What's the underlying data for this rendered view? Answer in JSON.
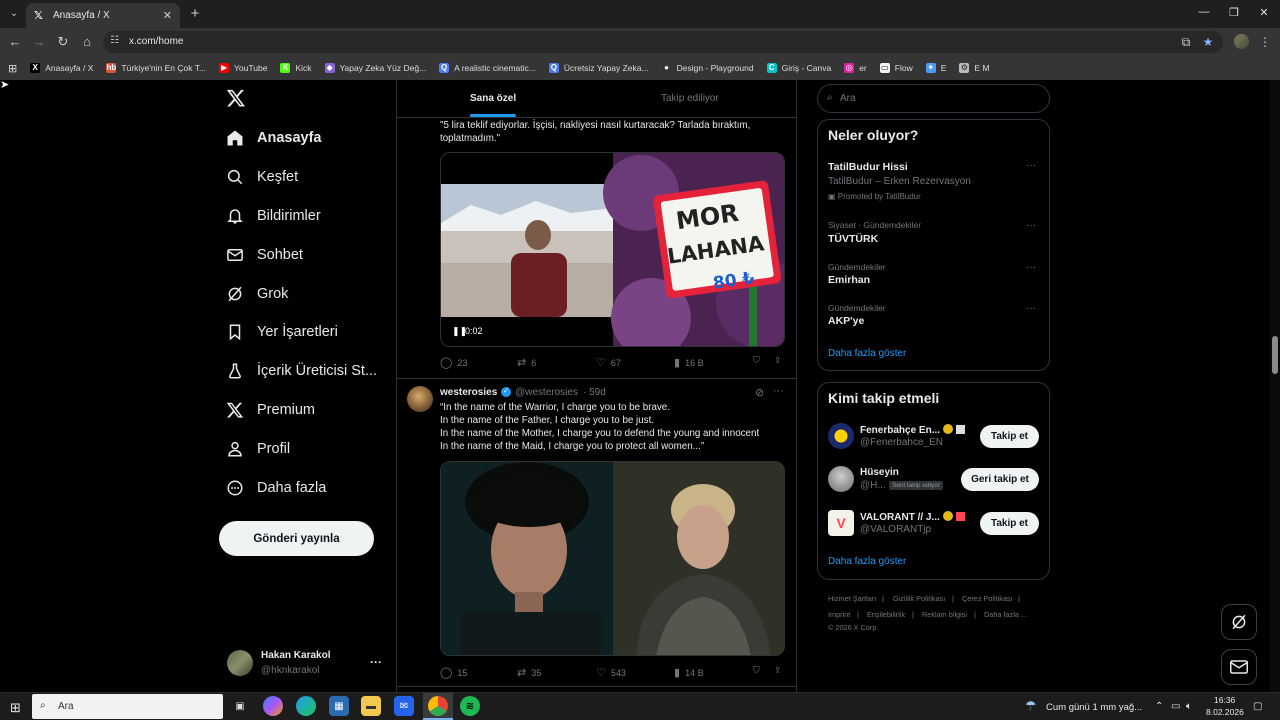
{
  "browser": {
    "tab_title": "Anasayfa / X",
    "url": "x.com/home",
    "bookmarks": [
      {
        "label": "Anasayfa / X",
        "color": "#000000",
        "glyph": "X"
      },
      {
        "label": "Türkiye'nin En Çok T...",
        "color": "#e0533a",
        "glyph": "hb"
      },
      {
        "label": "YouTube",
        "color": "#ff0000",
        "glyph": "▶"
      },
      {
        "label": "Kick",
        "color": "#53fc18",
        "glyph": "K"
      },
      {
        "label": "Yapay Zeka Yüz Değ...",
        "color": "#8a63d2",
        "glyph": "◆"
      },
      {
        "label": "A realistic cinematic...",
        "color": "#4b7bec",
        "glyph": "Q"
      },
      {
        "label": "Ücretsiz Yapay Zeka...",
        "color": "#4b7bec",
        "glyph": "Q"
      },
      {
        "label": "Design - Playground",
        "color": "#333333",
        "glyph": "●"
      },
      {
        "label": "Giriş - Canva",
        "color": "#00c4cc",
        "glyph": "C"
      },
      {
        "label": "er",
        "color": "#d6249f",
        "glyph": "◎"
      },
      {
        "label": "Flow",
        "color": "#f2f2f2",
        "glyph": "▭"
      },
      {
        "label": "E",
        "color": "#4b9cf5",
        "glyph": "✦"
      },
      {
        "label": "E M",
        "color": "#bbbbbb",
        "glyph": "⚙"
      }
    ]
  },
  "sidebar": {
    "items": [
      {
        "label": "Anasayfa",
        "icon": "home-icon"
      },
      {
        "label": "Keşfet",
        "icon": "search-icon"
      },
      {
        "label": "Bildirimler",
        "icon": "bell-icon"
      },
      {
        "label": "Sohbet",
        "icon": "mail-icon"
      },
      {
        "label": "Grok",
        "icon": "grok-icon"
      },
      {
        "label": "Yer İşaretleri",
        "icon": "bookmark-icon"
      },
      {
        "label": "İçerik Üreticisi St...",
        "icon": "flask-icon"
      },
      {
        "label": "Premium",
        "icon": "x-icon"
      },
      {
        "label": "Profil",
        "icon": "person-icon"
      },
      {
        "label": "Daha fazla",
        "icon": "more-circle-icon"
      }
    ],
    "post_button": "Gönderi yayınla",
    "profile": {
      "name": "Hakan Karakol",
      "handle": "@hknkarakol"
    }
  },
  "feed": {
    "tabs": [
      "Sana özel",
      "Takip ediliyor"
    ],
    "tweet1": {
      "text_lines": [
        "\"5 lira teklif ediyorlar. İşçisi, nakliyesi nasıl kurtaracak? Tarlada bıraktım,",
        "toplatmadım.\""
      ],
      "sign_line1": "MOR",
      "sign_line2": "LAHANA",
      "sign_price": "80 ₺",
      "video_time": "0:02",
      "replies": "23",
      "reposts": "6",
      "likes": "67",
      "views": "16 B"
    },
    "tweet2": {
      "author": "westerosies",
      "handle": "@westerosies",
      "age": "· 59d",
      "text_lines": [
        "“In the name of the Warrior, I charge you to be brave.",
        "In the name of the Father, I charge you to be just.",
        "In the name of the Mother, I charge you to defend the young and innocent",
        "In the name of the Maid, I charge you to protect all women...”"
      ],
      "replies": "15",
      "reposts": "35",
      "likes": "543",
      "views": "14 B"
    }
  },
  "right": {
    "search_placeholder": "Ara",
    "trends_title": "Neler oluyor?",
    "promo": {
      "name": "TatilBudur Hissi",
      "desc": "TatilBudur – Erken Rezervasyon",
      "tag": "Promoted by TatilBudur"
    },
    "trends": [
      {
        "meta": "Siyaset · Gündemdekiler",
        "name": "TÜVTÜRK"
      },
      {
        "meta": "Gündemdekiler",
        "name": "Emirhan"
      },
      {
        "meta": "Gündemdekiler",
        "name": "AKP'ye"
      }
    ],
    "show_more": "Daha fazla göster",
    "wtf_title": "Kimi takip etmeli",
    "wtf": [
      {
        "name": "Fenerbahçe En...",
        "handle": "@Fenerbahce_EN",
        "button": "Takip et",
        "avatar_color": "#1a2b6b"
      },
      {
        "name": "Hüseyin",
        "handle": "@H...",
        "badge": "Seni takip ediyor",
        "button": "Geri takip et",
        "avatar_color": "#8a8a8a"
      },
      {
        "name": "VALORANT // J...",
        "handle": "@VALORANTjp",
        "button": "Takip et",
        "avatar_color": "#f4f1ea"
      }
    ],
    "footer_row1": [
      "Hizmet Şartları",
      "Gizlilik Politikası",
      "Çerez Politikası"
    ],
    "footer_row2": [
      "Imprint",
      "Erişilebilirlik",
      "Reklam bilgisi",
      "Daha fazla ..."
    ],
    "copyright": "© 2026 X Corp."
  },
  "taskbar": {
    "search_placeholder": "Ara",
    "weather": "Cum günü 1 mm yağ...",
    "time": "16:36",
    "date": "8.02.2026"
  },
  "colors": {
    "accent": "#1d9bf0",
    "background": "#000000",
    "border": "#2f3336"
  }
}
